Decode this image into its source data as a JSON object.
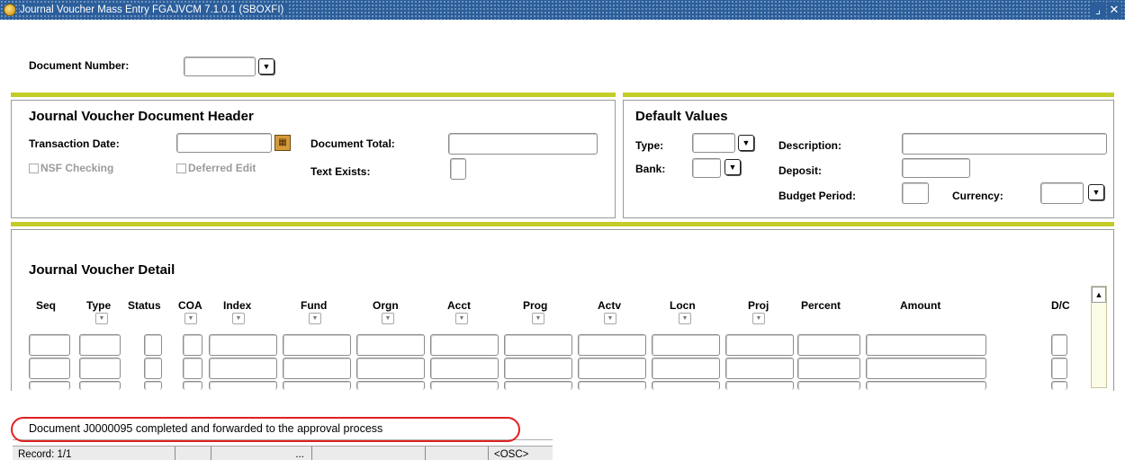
{
  "window": {
    "title": "Journal Voucher Mass Entry  FGAJVCM  7.1.0.1  (SBOXFI)",
    "minimize_glyph": "⌟",
    "close_glyph": "✕"
  },
  "key_block": {
    "document_number_label": "Document Number:",
    "document_number_value": ""
  },
  "header": {
    "title": "Journal Voucher Document Header",
    "transaction_date_label": "Transaction Date:",
    "transaction_date_value": "",
    "document_total_label": "Document Total:",
    "document_total_value": "",
    "nsf_checking_label": "NSF Checking",
    "deferred_edit_label": "Deferred Edit",
    "text_exists_label": "Text Exists:"
  },
  "defaults": {
    "title": "Default Values",
    "type_label": "Type:",
    "bank_label": "Bank:",
    "description_label": "Description:",
    "deposit_label": "Deposit:",
    "budget_period_label": "Budget Period:",
    "currency_label": "Currency:"
  },
  "detail": {
    "title": "Journal Voucher Detail",
    "columns": [
      "Seq",
      "Type",
      "Status",
      "COA",
      "Index",
      "Fund",
      "Orgn",
      "Acct",
      "Prog",
      "Actv",
      "Locn",
      "Proj",
      "Percent",
      "Amount",
      "D/C"
    ]
  },
  "status": {
    "message": "Document J0000095 completed and forwarded to the approval process",
    "record": "Record: 1/1",
    "ellipsis": "...",
    "osc": "<OSC>"
  },
  "icons": {
    "dropdown": "▼",
    "calendar": "▦",
    "scroll_up": "▲",
    "app": "app-globe-icon"
  }
}
